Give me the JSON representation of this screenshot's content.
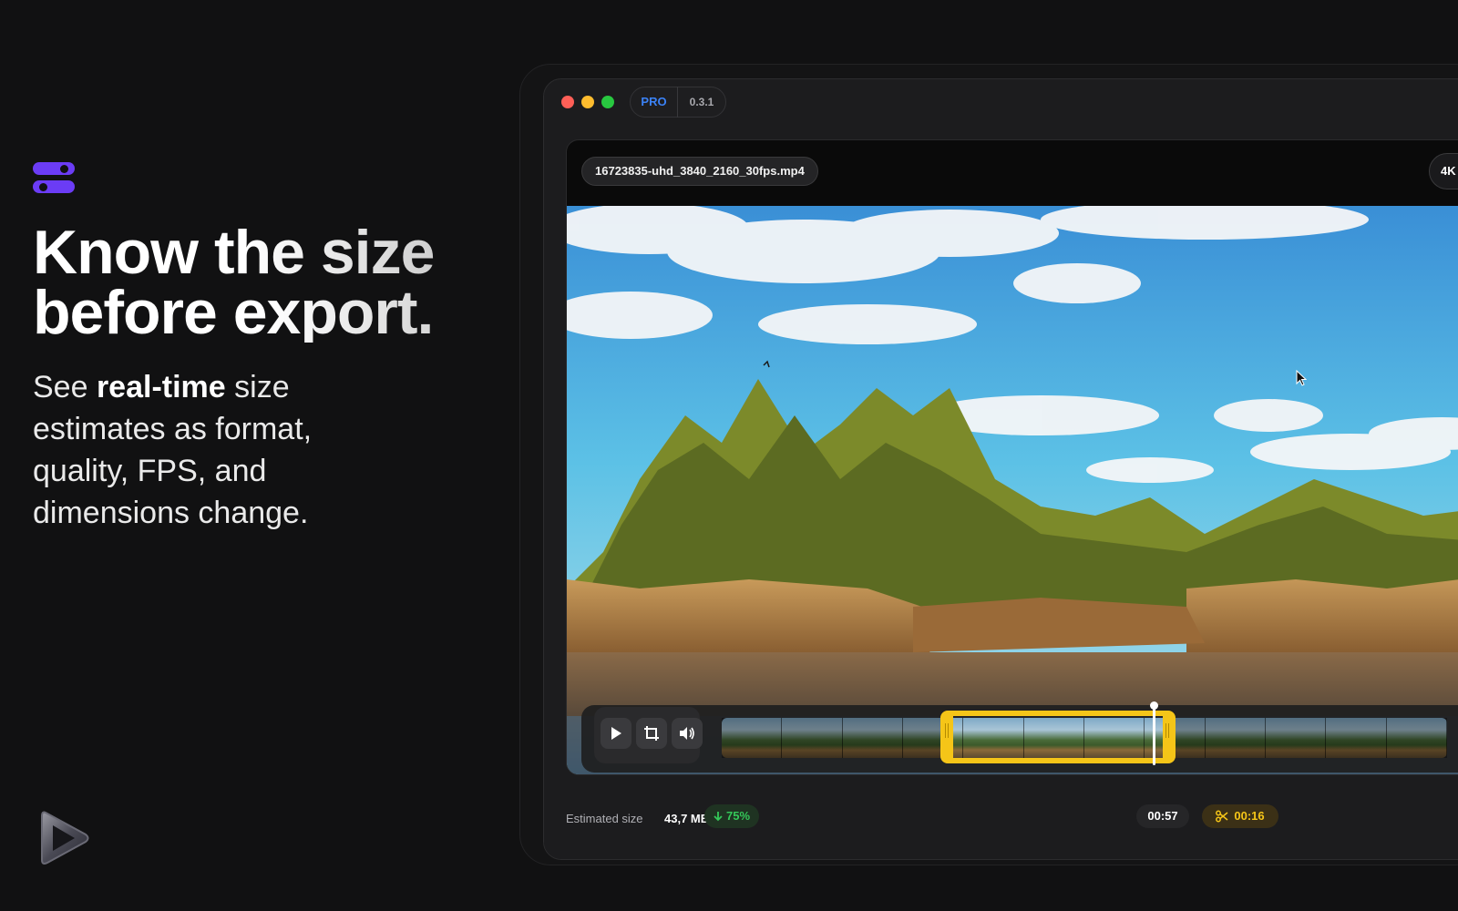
{
  "marketing": {
    "headline_line1": "Know the size",
    "headline_line2": "before export.",
    "subtext_before": "See ",
    "subtext_bold": "real-time",
    "subtext_after": " size estimates as format, quality, FPS, and dimensions change.",
    "feature_icon": "toggle-stack-icon",
    "brand_icon": "play-logo-icon",
    "accent_color": "#6b3cf5"
  },
  "window": {
    "badge_tier": "PRO",
    "badge_version": "0.3.1",
    "traffic_lights": [
      "close",
      "minimize",
      "zoom"
    ]
  },
  "player": {
    "filename": "16723835-uhd_3840_2160_30fps.mp4",
    "resolution_badge": "4K",
    "controls": [
      "play-icon",
      "crop-icon",
      "volume-icon"
    ]
  },
  "timeline": {
    "selection_color": "#f5c518"
  },
  "footer": {
    "estimated_size_label": "Estimated size",
    "estimated_size_value": "43,7 MB",
    "savings": "75%",
    "duration": "00:57",
    "trim_duration": "00:16"
  }
}
